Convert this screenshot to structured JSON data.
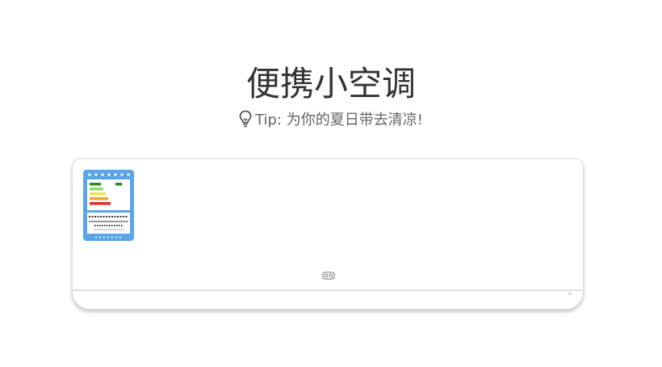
{
  "page": {
    "title": "便携小空调",
    "tip": "Tip: 为你的夏日带去清凉!"
  },
  "icons": {
    "tip": "lightbulb-icon",
    "energy_label": "energy-label-icon",
    "display": "display-indicator-icon"
  },
  "colors": {
    "title_text": "#333333",
    "tip_text": "#666666",
    "label_frame": "#5aa5ea",
    "energy_bars": [
      "#2e8b22",
      "#93d66a",
      "#f1dd4f",
      "#f3a227",
      "#e02d2a"
    ]
  }
}
